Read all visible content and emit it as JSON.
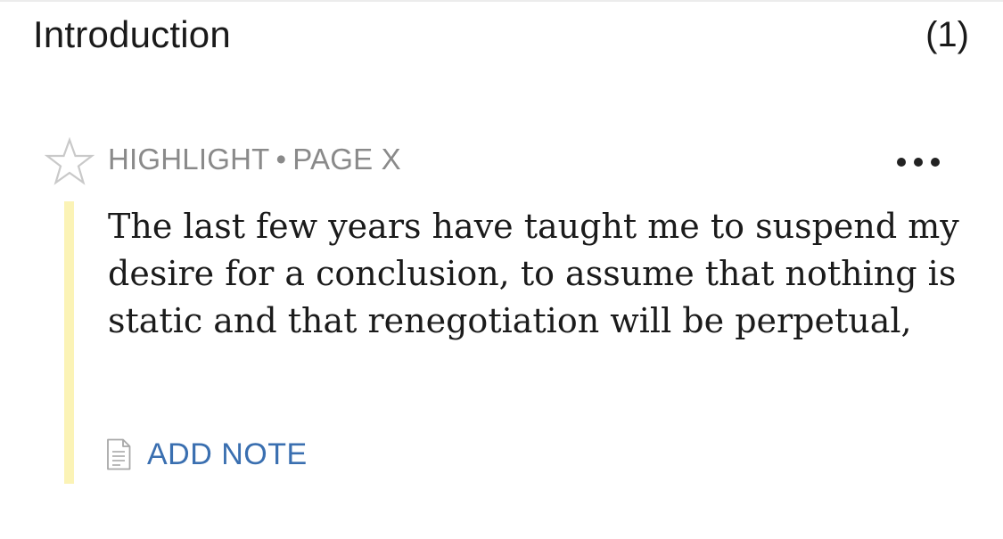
{
  "section": {
    "title": "Introduction",
    "count": "(1)"
  },
  "highlight": {
    "type_label": "HIGHLIGHT",
    "separator": "•",
    "page_label": "PAGE X",
    "text": "The last few years have taught me to suspend my desire for a conclusion, to assume that nothing is static and that renegotiation will be perpetual,",
    "highlight_color": "#fbf3b6",
    "add_note_label": "ADD NOTE",
    "add_note_color": "#3a6fb0",
    "star_icon": "star-outline-icon",
    "more_icon": "more-horizontal-icon",
    "note_icon": "note-document-icon"
  }
}
